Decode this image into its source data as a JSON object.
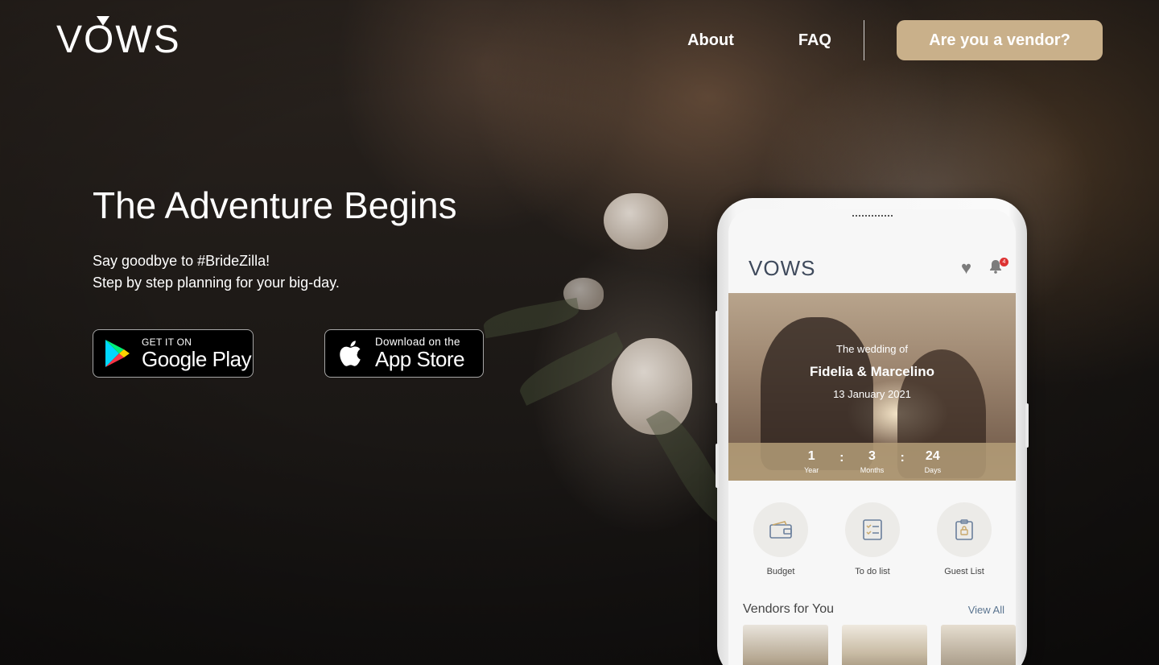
{
  "header": {
    "logo": "VOWS",
    "nav": {
      "about": "About",
      "faq": "FAQ"
    },
    "vendor_button": "Are you a vendor?"
  },
  "hero": {
    "title": "The Adventure Begins",
    "subtitle_line1": "Say goodbye to #BrideZilla!",
    "subtitle_line2": "Step by step planning for your big-day."
  },
  "stores": {
    "google_play": {
      "small": "GET IT ON",
      "big": "Google Play"
    },
    "app_store": {
      "small": "Download on the",
      "big": "App Store"
    }
  },
  "phone": {
    "app_logo": "VOWS",
    "notification_count": "4",
    "banner": {
      "caption": "The wedding of",
      "names": "Fidelia & Marcelino",
      "date": "13 January 2021"
    },
    "countdown": [
      {
        "value": "1",
        "label": "Year"
      },
      {
        "value": "3",
        "label": "Months"
      },
      {
        "value": "24",
        "label": "Days"
      }
    ],
    "menu": [
      {
        "label": "Budget",
        "icon": "wallet-icon"
      },
      {
        "label": "To do list",
        "icon": "checklist-icon"
      },
      {
        "label": "Guest List",
        "icon": "clipboard-lock-icon"
      }
    ],
    "vendors_title": "Vendors for You",
    "view_all": "View All"
  },
  "colors": {
    "accent": "#c9b08a",
    "countdown_bg": "#b49e78"
  }
}
